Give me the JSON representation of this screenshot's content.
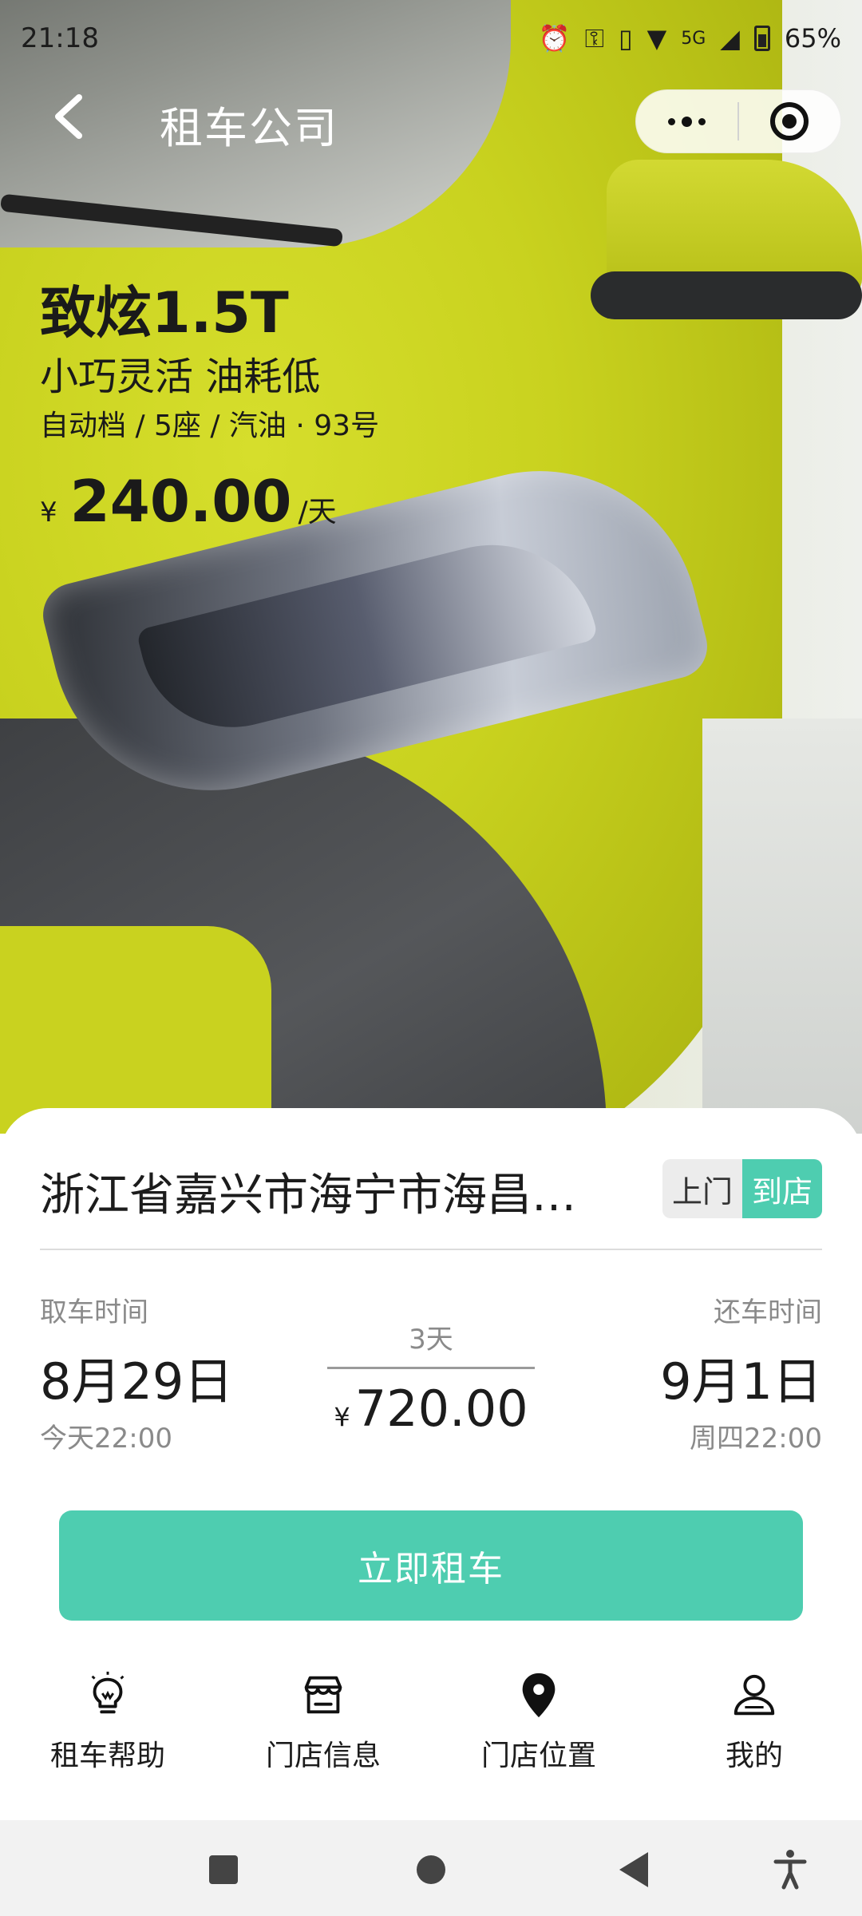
{
  "status_bar": {
    "time": "21:18",
    "icons": [
      "alarm-icon",
      "key-icon",
      "data-saver-icon",
      "wifi-icon",
      "5g-icon",
      "signal-icon",
      "battery-icon"
    ],
    "network": "5G",
    "battery": "65%"
  },
  "nav": {
    "title": "租车公司",
    "back_icon": "chevron-left-icon",
    "more_icon": "more-dots-icon",
    "close_icon": "target-icon"
  },
  "car": {
    "name": "致炫1.5T",
    "slogan": "小巧灵活 油耗低",
    "spec": "自动档 / 5座 / 汽油 · 93号",
    "price_currency": "¥",
    "price": "240.00",
    "price_unit": "/天",
    "hero_colors": {
      "body": "#c9d21f",
      "trim": "#3b3d40"
    }
  },
  "booking": {
    "address": "浙江省嘉兴市海宁市海昌…",
    "mode_options": [
      "上门",
      "到店"
    ],
    "mode_selected": "到店",
    "pickup": {
      "label": "取车时间",
      "date": "8月29日",
      "time": "今天22:00"
    },
    "return": {
      "label": "还车时间",
      "date": "9月1日",
      "time": "周四22:00"
    },
    "duration": "3天",
    "total_currency": "¥",
    "total": "720.00",
    "cta_label": "立即租车",
    "accent_color": "#4ecdb0"
  },
  "tabbar": {
    "items": [
      {
        "label": "租车帮助",
        "icon": "lightbulb-icon"
      },
      {
        "label": "门店信息",
        "icon": "store-icon"
      },
      {
        "label": "门店位置",
        "icon": "location-pin-icon"
      },
      {
        "label": "我的",
        "icon": "user-icon"
      }
    ]
  },
  "system_nav": {
    "icons": [
      "recents-icon",
      "home-icon",
      "back-icon",
      "accessibility-icon"
    ]
  }
}
